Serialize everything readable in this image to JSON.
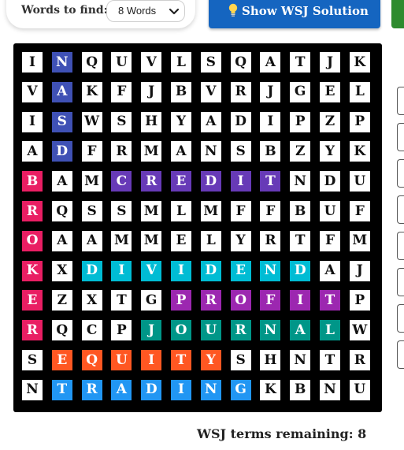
{
  "toolbar": {
    "words_label": "Words to find:",
    "words_select_value": "8 Words",
    "solution_button_label": "Show WSJ Solution"
  },
  "grid": {
    "rows": [
      "INQUVLSQATJK",
      "VAKFJBVRJGEL",
      "ISWSHYADIPZP",
      "ADFRMANSBZYK",
      "BAMCREDITNDU",
      "RQSSMLMFFBUF",
      "OAAMMELYRTFM",
      "KXDIVIDENDAJ",
      "EZXTGPROFITP",
      "RQCPJOURNALW",
      "SEQUITYSHNTR",
      "NTRADINGKBNU"
    ]
  },
  "found_words": [
    {
      "word": "NASDAQ",
      "color": "#3f51b5",
      "cells": [
        [
          0,
          1
        ],
        [
          1,
          1
        ],
        [
          2,
          1
        ],
        [
          3,
          1
        ]
      ]
    },
    {
      "word": "BROKER",
      "color": "#e91e63",
      "cells": [
        [
          4,
          0
        ],
        [
          5,
          0
        ],
        [
          6,
          0
        ],
        [
          7,
          0
        ],
        [
          8,
          0
        ],
        [
          9,
          0
        ]
      ]
    },
    {
      "word": "CREDIT",
      "color": "#673ab7",
      "cells": [
        [
          4,
          3
        ],
        [
          4,
          4
        ],
        [
          4,
          5
        ],
        [
          4,
          6
        ],
        [
          4,
          7
        ],
        [
          4,
          8
        ]
      ]
    },
    {
      "word": "DIVIDEND",
      "color": "#00bcd4",
      "cells": [
        [
          7,
          2
        ],
        [
          7,
          3
        ],
        [
          7,
          4
        ],
        [
          7,
          5
        ],
        [
          7,
          6
        ],
        [
          7,
          7
        ],
        [
          7,
          8
        ],
        [
          7,
          9
        ]
      ]
    },
    {
      "word": "PROFIT",
      "color": "#9c27b0",
      "cells": [
        [
          8,
          5
        ],
        [
          8,
          6
        ],
        [
          8,
          7
        ],
        [
          8,
          8
        ],
        [
          8,
          9
        ],
        [
          8,
          10
        ]
      ]
    },
    {
      "word": "JOURNAL",
      "color": "#009688",
      "cells": [
        [
          9,
          4
        ],
        [
          9,
          5
        ],
        [
          9,
          6
        ],
        [
          9,
          7
        ],
        [
          9,
          8
        ],
        [
          9,
          9
        ],
        [
          9,
          10
        ]
      ]
    },
    {
      "word": "EQUITY",
      "color": "#ff5722",
      "cells": [
        [
          10,
          1
        ],
        [
          10,
          2
        ],
        [
          10,
          3
        ],
        [
          10,
          4
        ],
        [
          10,
          5
        ],
        [
          10,
          6
        ]
      ]
    },
    {
      "word": "TRADING",
      "color": "#2196f3",
      "cells": [
        [
          11,
          1
        ],
        [
          11,
          2
        ],
        [
          11,
          3
        ],
        [
          11,
          4
        ],
        [
          11,
          5
        ],
        [
          11,
          6
        ],
        [
          11,
          7
        ]
      ]
    }
  ],
  "status": {
    "remaining_text": "WSJ terms remaining: 8"
  },
  "colors": {
    "board_bg": "#000000",
    "cell_bg": "#ffffff",
    "cell_text": "#111111",
    "found_text": "#ffffff",
    "button_blue": "#1565c0",
    "button_green": "#2e8b2e"
  }
}
